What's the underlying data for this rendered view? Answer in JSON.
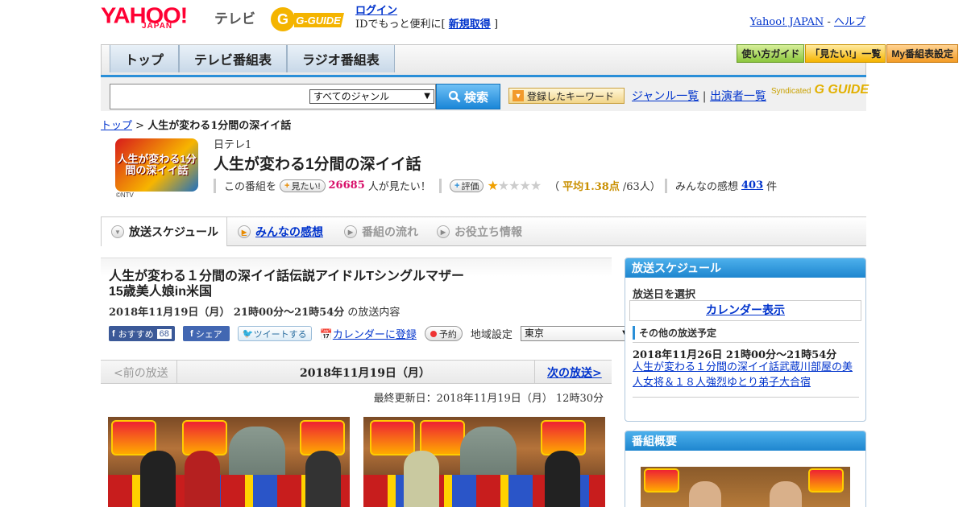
{
  "header": {
    "logo": "YAHOO!",
    "logo_sub": "JAPAN",
    "tv_label": "テレビ",
    "gguide_logo": "G-GUIDE",
    "login_link": "ログイン",
    "login_desc": "IDでもっと便利に[",
    "signup_link": "新規取得",
    "signup_close": "]",
    "yahoo_japan_link": "Yahoo! JAPAN",
    "separator": "-",
    "help_link": "ヘルプ"
  },
  "nav": {
    "tabs": [
      "トップ",
      "テレビ番組表",
      "ラジオ番組表"
    ],
    "buttons": [
      "使い方ガイド",
      "「見たい!」一覧",
      "My番組表設定"
    ]
  },
  "search": {
    "genre_selected": "すべてのジャンル",
    "search_button": "検索",
    "keyword_button": "登録したキーワード",
    "genre_list_link": "ジャンル一覧",
    "divider": "|",
    "performer_list_link": "出演者一覧",
    "syndicated": "Syndicated",
    "syndicated_logo": "G GUIDE"
  },
  "breadcrumb": {
    "home": "トップ",
    "sep": ">",
    "current": "人生が変わる1分間の深イイ話"
  },
  "program": {
    "logo_text": "人生が変わる1分間の深イイ話",
    "copyright": "©NTV",
    "station": "日テレ1",
    "title": "人生が変わる1分間の深イイ話",
    "want_prefix": "この番組を",
    "want_button": "見たい!",
    "want_count": "26685",
    "want_suffix": "人が見たい！",
    "rate_button": "評価",
    "stars_on": "★",
    "stars_off": "★★★★",
    "avg_open": "（",
    "avg_label": "平均1.38点",
    "avg_count": "/63人）",
    "reviews_prefix": "みんなの感想",
    "reviews_count": "403",
    "reviews_suffix": "件"
  },
  "program_tabs": [
    {
      "label": "放送スケジュール"
    },
    {
      "label": "みんなの感想"
    },
    {
      "label": "番組の流れ"
    },
    {
      "label": "お役立ち情報"
    }
  ],
  "episode": {
    "title_line1": "人生が変わる１分間の深イイ話伝説アイドルTシングルマザー",
    "title_line2": "15歳美人娘in米国",
    "date_time": "2018年11月19日（月）  21時00分～21時54分",
    "date_suffix": "の放送内容",
    "fb_recommend": "おすすめ",
    "fb_count": "68",
    "fb_share": "シェア",
    "tweet": "ツイートする",
    "calendar_register": "カレンダーに登録",
    "reserve": "予約",
    "region_label": "地域設定",
    "region_value": "東京",
    "prev": "<前の放送",
    "current_date": "2018年11月19日（月）",
    "next": "次の放送>",
    "updated": "最終更新日：2018年11月19日（月）  12時30分"
  },
  "sidebar": {
    "schedule_head": "放送スケジュール",
    "select_date": "放送日を選択",
    "calendar_link": "カレンダー表示",
    "other_label": "その他の放送予定",
    "next_date": "2018年11月26日  21時00分～21時54分",
    "next_title": "人生が変わる１分間の深イイ話武蔵川部屋の美人女将＆１８人強烈ゆとり弟子大合宿",
    "overview_head": "番組概要"
  }
}
